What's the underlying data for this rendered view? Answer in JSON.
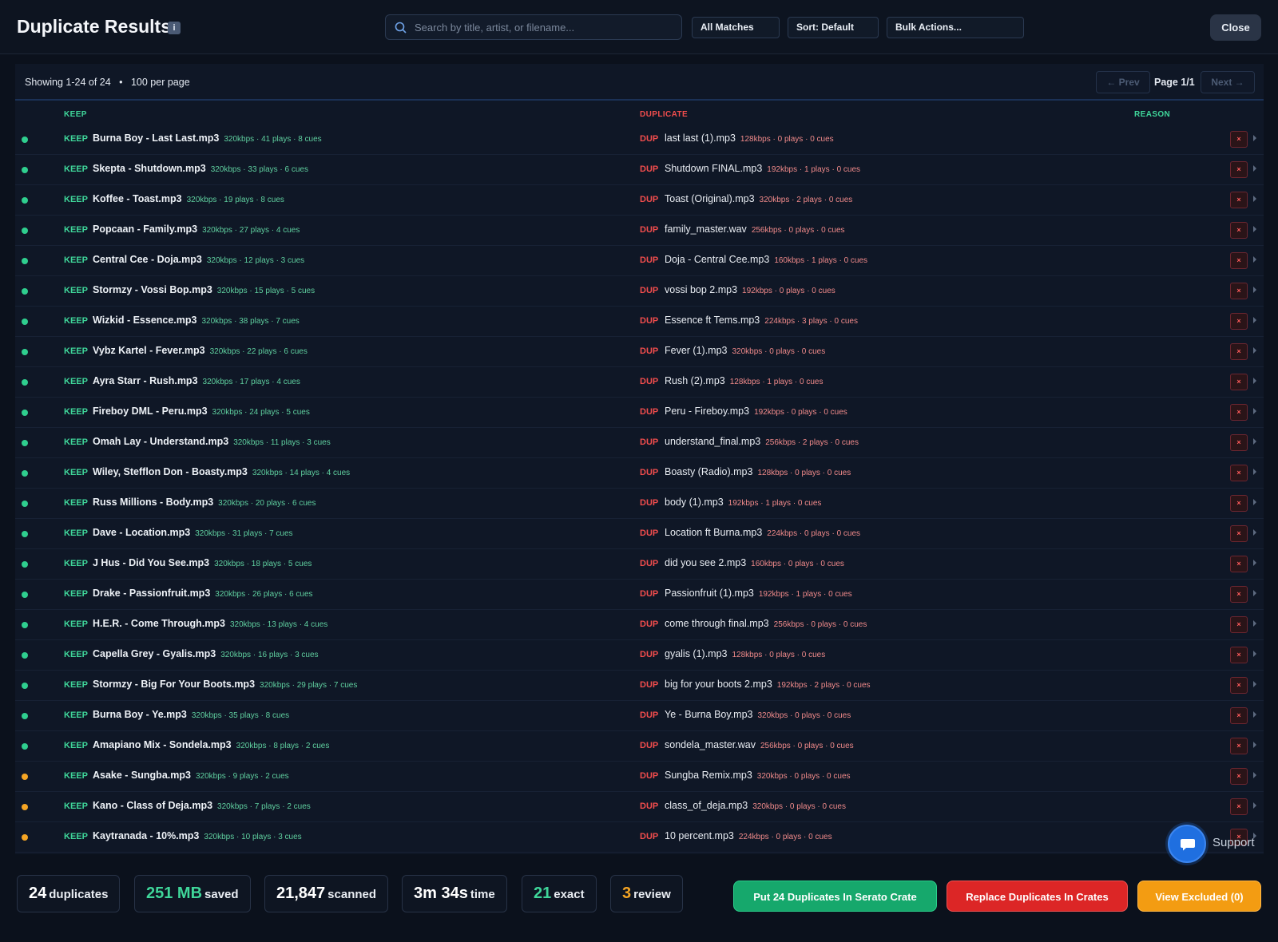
{
  "header": {
    "title": "Duplicate Results",
    "info_icon": "i",
    "search_placeholder": "Search by title, artist, or filename...",
    "filter_label": "All Matches",
    "sort_label": "Sort: Default",
    "bulk_label": "Bulk Actions...",
    "close_label": "Close"
  },
  "pager": {
    "showing": "Showing 1-24 of 24",
    "per_page": "100 per page",
    "prev_label": "← Prev",
    "page_label": "Page 1/1",
    "next_label": "Next →"
  },
  "columns": {
    "keep": "KEEP",
    "duplicate": "DUPLICATE",
    "reason": "REASON"
  },
  "row_tags": {
    "keep": "KEEP",
    "dup": "DUP",
    "remove": "×"
  },
  "status_colors": {
    "exact": "#2fcf8f",
    "review": "#f5a524"
  },
  "rows": [
    {
      "status": "exact",
      "keep_name": "Burna Boy - Last Last.mp3",
      "keep_meta": "320kbps · 41 plays · 8 cues",
      "dup_name": "last last (1).mp3",
      "dup_meta": "128kbps · 0 plays · 0 cues"
    },
    {
      "status": "exact",
      "keep_name": "Skepta - Shutdown.mp3",
      "keep_meta": "320kbps · 33 plays · 6 cues",
      "dup_name": "Shutdown FINAL.mp3",
      "dup_meta": "192kbps · 1 plays · 0 cues"
    },
    {
      "status": "exact",
      "keep_name": "Koffee - Toast.mp3",
      "keep_meta": "320kbps · 19 plays · 8 cues",
      "dup_name": "Toast (Original).mp3",
      "dup_meta": "320kbps · 2 plays · 0 cues"
    },
    {
      "status": "exact",
      "keep_name": "Popcaan - Family.mp3",
      "keep_meta": "320kbps · 27 plays · 4 cues",
      "dup_name": "family_master.wav",
      "dup_meta": "256kbps · 0 plays · 0 cues"
    },
    {
      "status": "exact",
      "keep_name": "Central Cee - Doja.mp3",
      "keep_meta": "320kbps · 12 plays · 3 cues",
      "dup_name": "Doja - Central Cee.mp3",
      "dup_meta": "160kbps · 1 plays · 0 cues"
    },
    {
      "status": "exact",
      "keep_name": "Stormzy - Vossi Bop.mp3",
      "keep_meta": "320kbps · 15 plays · 5 cues",
      "dup_name": "vossi bop 2.mp3",
      "dup_meta": "192kbps · 0 plays · 0 cues"
    },
    {
      "status": "exact",
      "keep_name": "Wizkid - Essence.mp3",
      "keep_meta": "320kbps · 38 plays · 7 cues",
      "dup_name": "Essence ft Tems.mp3",
      "dup_meta": "224kbps · 3 plays · 0 cues"
    },
    {
      "status": "exact",
      "keep_name": "Vybz Kartel - Fever.mp3",
      "keep_meta": "320kbps · 22 plays · 6 cues",
      "dup_name": "Fever (1).mp3",
      "dup_meta": "320kbps · 0 plays · 0 cues"
    },
    {
      "status": "exact",
      "keep_name": "Ayra Starr - Rush.mp3",
      "keep_meta": "320kbps · 17 plays · 4 cues",
      "dup_name": "Rush (2).mp3",
      "dup_meta": "128kbps · 1 plays · 0 cues"
    },
    {
      "status": "exact",
      "keep_name": "Fireboy DML - Peru.mp3",
      "keep_meta": "320kbps · 24 plays · 5 cues",
      "dup_name": "Peru - Fireboy.mp3",
      "dup_meta": "192kbps · 0 plays · 0 cues"
    },
    {
      "status": "exact",
      "keep_name": "Omah Lay - Understand.mp3",
      "keep_meta": "320kbps · 11 plays · 3 cues",
      "dup_name": "understand_final.mp3",
      "dup_meta": "256kbps · 2 plays · 0 cues"
    },
    {
      "status": "exact",
      "keep_name": "Wiley, Stefflon Don - Boasty.mp3",
      "keep_meta": "320kbps · 14 plays · 4 cues",
      "dup_name": "Boasty (Radio).mp3",
      "dup_meta": "128kbps · 0 plays · 0 cues"
    },
    {
      "status": "exact",
      "keep_name": "Russ Millions - Body.mp3",
      "keep_meta": "320kbps · 20 plays · 6 cues",
      "dup_name": "body (1).mp3",
      "dup_meta": "192kbps · 1 plays · 0 cues"
    },
    {
      "status": "exact",
      "keep_name": "Dave - Location.mp3",
      "keep_meta": "320kbps · 31 plays · 7 cues",
      "dup_name": "Location ft Burna.mp3",
      "dup_meta": "224kbps · 0 plays · 0 cues"
    },
    {
      "status": "exact",
      "keep_name": "J Hus - Did You See.mp3",
      "keep_meta": "320kbps · 18 plays · 5 cues",
      "dup_name": "did you see 2.mp3",
      "dup_meta": "160kbps · 0 plays · 0 cues"
    },
    {
      "status": "exact",
      "keep_name": "Drake - Passionfruit.mp3",
      "keep_meta": "320kbps · 26 plays · 6 cues",
      "dup_name": "Passionfruit (1).mp3",
      "dup_meta": "192kbps · 1 plays · 0 cues"
    },
    {
      "status": "exact",
      "keep_name": "H.E.R. - Come Through.mp3",
      "keep_meta": "320kbps · 13 plays · 4 cues",
      "dup_name": "come through final.mp3",
      "dup_meta": "256kbps · 0 plays · 0 cues"
    },
    {
      "status": "exact",
      "keep_name": "Capella Grey - Gyalis.mp3",
      "keep_meta": "320kbps · 16 plays · 3 cues",
      "dup_name": "gyalis (1).mp3",
      "dup_meta": "128kbps · 0 plays · 0 cues"
    },
    {
      "status": "exact",
      "keep_name": "Stormzy - Big For Your Boots.mp3",
      "keep_meta": "320kbps · 29 plays · 7 cues",
      "dup_name": "big for your boots 2.mp3",
      "dup_meta": "192kbps · 2 plays · 0 cues"
    },
    {
      "status": "exact",
      "keep_name": "Burna Boy - Ye.mp3",
      "keep_meta": "320kbps · 35 plays · 8 cues",
      "dup_name": "Ye - Burna Boy.mp3",
      "dup_meta": "320kbps · 0 plays · 0 cues"
    },
    {
      "status": "exact",
      "keep_name": "Amapiano Mix - Sondela.mp3",
      "keep_meta": "320kbps · 8 plays · 2 cues",
      "dup_name": "sondela_master.wav",
      "dup_meta": "256kbps · 0 plays · 0 cues"
    },
    {
      "status": "review",
      "keep_name": "Asake - Sungba.mp3",
      "keep_meta": "320kbps · 9 plays · 2 cues",
      "dup_name": "Sungba Remix.mp3",
      "dup_meta": "320kbps · 0 plays · 0 cues"
    },
    {
      "status": "review",
      "keep_name": "Kano - Class of Deja.mp3",
      "keep_meta": "320kbps · 7 plays · 2 cues",
      "dup_name": "class_of_deja.mp3",
      "dup_meta": "320kbps · 0 plays · 0 cues"
    },
    {
      "status": "review",
      "keep_name": "Kaytranada - 10%.mp3",
      "keep_meta": "320kbps · 10 plays · 3 cues",
      "dup_name": "10 percent.mp3",
      "dup_meta": "224kbps · 0 plays · 0 cues"
    }
  ],
  "stats": [
    {
      "num": "24",
      "label": "duplicates",
      "color": "#ffffff"
    },
    {
      "num": "251 MB",
      "label": "saved",
      "color": "#3fd69a"
    },
    {
      "num": "21,847",
      "label": "scanned",
      "color": "#ffffff"
    },
    {
      "num": "3m 34s",
      "label": "time",
      "color": "#ffffff"
    },
    {
      "num": "21",
      "label": "exact",
      "color": "#3fd69a"
    },
    {
      "num": "3",
      "label": "review",
      "color": "#f5a524"
    }
  ],
  "actions": {
    "serato": "Put 24 Duplicates In Serato Crate",
    "replace": "Replace Duplicates In Crates",
    "excluded": "View Excluded (0)"
  },
  "support": {
    "label": "Support",
    "icon": "chat-bubble-icon"
  }
}
